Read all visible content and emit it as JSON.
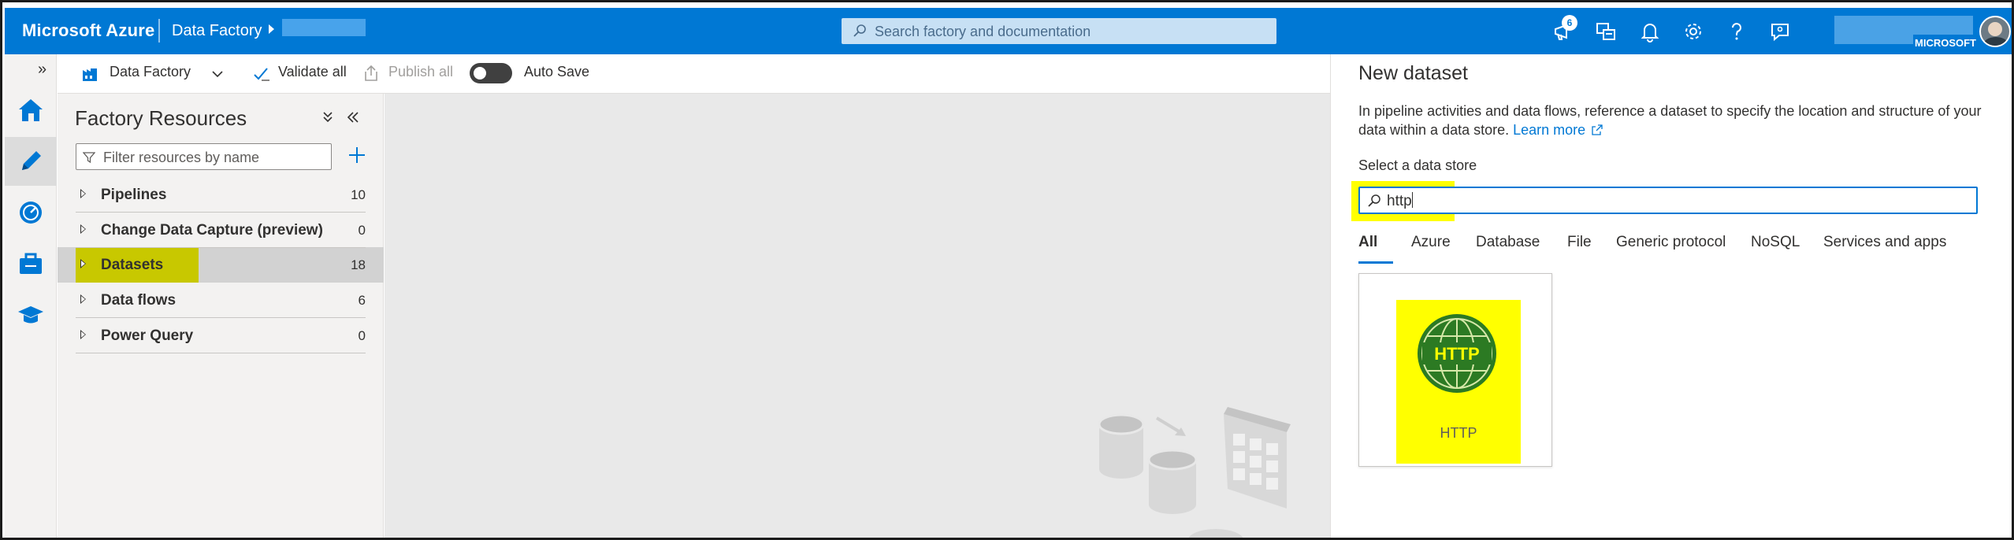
{
  "topbar": {
    "brand": "Microsoft Azure",
    "breadcrumb": "Data Factory",
    "search_placeholder": "Search factory and documentation",
    "notification_count": "6",
    "account_org": "MICROSOFT"
  },
  "toolbar": {
    "factory_label": "Data Factory",
    "validate_label": "Validate all",
    "publish_label": "Publish all",
    "autosave_label": "Auto Save"
  },
  "resources": {
    "title": "Factory Resources",
    "filter_placeholder": "Filter resources by name",
    "items": [
      {
        "label": "Pipelines",
        "count": "10"
      },
      {
        "label": "Change Data Capture (preview)",
        "count": "0"
      },
      {
        "label": "Datasets",
        "count": "18"
      },
      {
        "label": "Data flows",
        "count": "6"
      },
      {
        "label": "Power Query",
        "count": "0"
      }
    ]
  },
  "panel": {
    "title": "New dataset",
    "description": "In pipeline activities and data flows, reference a dataset to specify the location and structure of your data within a data store.",
    "learn_more": "Learn more",
    "select_label": "Select a data store",
    "search_value": "http",
    "tabs": [
      "All",
      "Azure",
      "Database",
      "File",
      "Generic protocol",
      "NoSQL",
      "Services and apps"
    ],
    "tile": {
      "logo_text": "HTTP",
      "label": "HTTP"
    }
  },
  "colors": {
    "azure_blue": "#0078d4",
    "highlight_yellow": "#ffff00",
    "dataset_highlight": "#c8c800",
    "http_green": "#2c7a23"
  }
}
